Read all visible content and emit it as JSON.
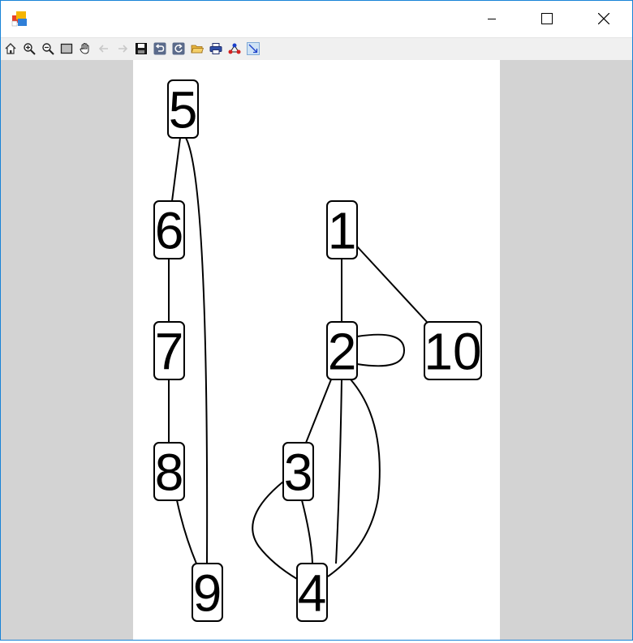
{
  "window": {
    "title": "",
    "controls": {
      "minimize_icon": "minimize-icon",
      "maximize_icon": "maximize-icon",
      "close_icon": "close-icon"
    },
    "border_color": "#1883d7"
  },
  "toolbar": {
    "items": [
      {
        "name": "home",
        "icon": "home-icon",
        "enabled": true
      },
      {
        "name": "zoom-in",
        "icon": "zoom-in-icon",
        "enabled": true
      },
      {
        "name": "zoom-out",
        "icon": "zoom-out-icon",
        "enabled": true
      },
      {
        "name": "zoom-to-fit",
        "icon": "fit-rectangle-icon",
        "enabled": true
      },
      {
        "name": "pan",
        "icon": "hand-icon",
        "enabled": true
      },
      {
        "name": "back",
        "icon": "back-arrow-icon",
        "enabled": false
      },
      {
        "name": "forward",
        "icon": "forward-arrow-icon",
        "enabled": false
      },
      {
        "name": "save",
        "icon": "save-icon",
        "enabled": true
      },
      {
        "name": "undo",
        "icon": "undo-icon",
        "enabled": true
      },
      {
        "name": "redo",
        "icon": "redo-icon",
        "enabled": true
      },
      {
        "name": "open",
        "icon": "folder-open-icon",
        "enabled": true
      },
      {
        "name": "print",
        "icon": "printer-icon",
        "enabled": true
      },
      {
        "name": "layout",
        "icon": "graph-layout-icon",
        "enabled": true
      },
      {
        "name": "edge-tool",
        "icon": "edge-arrow-icon",
        "enabled": true
      }
    ]
  },
  "graph": {
    "nodes": [
      {
        "id": "1",
        "label": "1"
      },
      {
        "id": "2",
        "label": "2"
      },
      {
        "id": "3",
        "label": "3"
      },
      {
        "id": "4",
        "label": "4"
      },
      {
        "id": "5",
        "label": "5"
      },
      {
        "id": "6",
        "label": "6"
      },
      {
        "id": "7",
        "label": "7"
      },
      {
        "id": "8",
        "label": "8"
      },
      {
        "id": "9",
        "label": "9"
      },
      {
        "id": "10",
        "label": "10"
      }
    ],
    "edges": [
      {
        "from": "5",
        "to": "6"
      },
      {
        "from": "5",
        "to": "9"
      },
      {
        "from": "6",
        "to": "7"
      },
      {
        "from": "7",
        "to": "8"
      },
      {
        "from": "8",
        "to": "9"
      },
      {
        "from": "1",
        "to": "2"
      },
      {
        "from": "1",
        "to": "10"
      },
      {
        "from": "2",
        "to": "2"
      },
      {
        "from": "2",
        "to": "3"
      },
      {
        "from": "2",
        "to": "4"
      },
      {
        "from": "2",
        "to": "4"
      },
      {
        "from": "3",
        "to": "4"
      },
      {
        "from": "3",
        "to": "4"
      }
    ]
  },
  "colors": {
    "canvas_bg": "#ffffff",
    "surround_bg": "#d3d3d3",
    "toolbar_bg": "#f0f0f0"
  }
}
